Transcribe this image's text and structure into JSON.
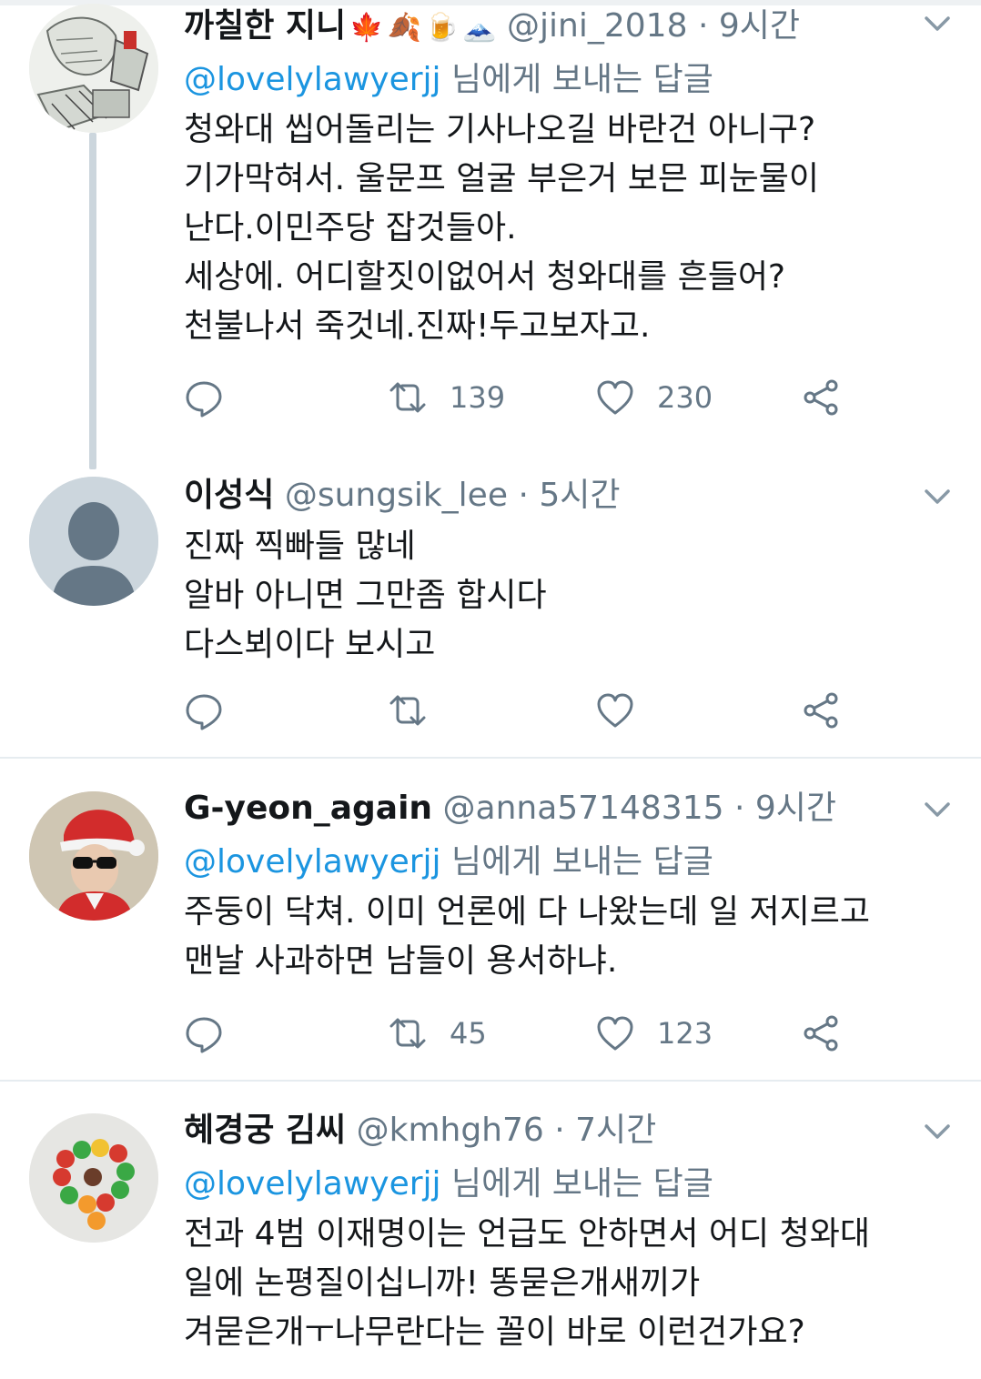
{
  "tweets": [
    {
      "name": "까칠한 지니",
      "emojis": [
        "🍁",
        "🍂",
        "🍺",
        "🗻"
      ],
      "handle": "@jini_2018",
      "time": "· 9시간",
      "reply_to": {
        "mention": "@lovelylawyerjj",
        "suffix": " 님에게 보내는 답글"
      },
      "text": "청와대 씹어돌리는 기사나오길 바란건 아니구?\n기가막혀서. 울문프 얼굴 부은거 보믄 피눈물이\n난다.이민주당 잡것들아.\n세상에. 어디할짓이없어서 청와대를 흔들어?\n천불나서 죽것네.진짜!두고보자고.",
      "retweets": "139",
      "likes": "230"
    },
    {
      "name": "이성식",
      "handle": "@sungsik_lee",
      "time": "· 5시간",
      "text": "진짜 찍빠들 많네\n알바 아니면 그만좀 합시다\n다스뵈이다 보시고",
      "retweets": "",
      "likes": ""
    },
    {
      "name": "G-yeon_again",
      "handle": "@anna57148315",
      "time": "· 9시간",
      "reply_to": {
        "mention": "@lovelylawyerjj",
        "suffix": " 님에게 보내는 답글"
      },
      "text": "주둥이 닥쳐. 이미 언론에 다 나왔는데 일 저지르고\n맨날 사과하면 남들이 용서하냐.",
      "retweets": "45",
      "likes": "123"
    },
    {
      "name": "혜경궁 김씨",
      "handle": "@kmhgh76",
      "time": "· 7시간",
      "reply_to": {
        "mention": "@lovelylawyerjj",
        "suffix": " 님에게 보내는 답글"
      },
      "text": "전과 4범 이재명이는 언급도 안하면서 어디 청와대\n일에 논평질이십니까! 똥묻은개새끼가\n겨묻은개ㅜ나무란다는 꼴이 바로 이런건가요?"
    }
  ],
  "colors": {
    "link": "#1b95e0",
    "muted": "#657786",
    "text": "#14171a"
  }
}
